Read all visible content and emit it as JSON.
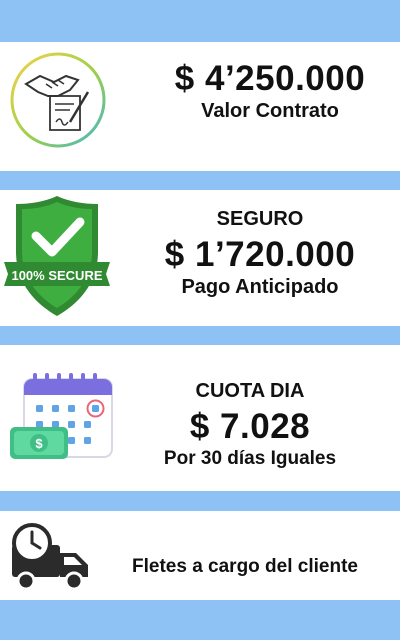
{
  "contract": {
    "amount": "$ 4’250.000",
    "label": "Valor Contrato",
    "icon": "handshake-contract-icon"
  },
  "insurance": {
    "title": "SEGURO",
    "amount": "$ 1’720.000",
    "label": "Pago Anticipado",
    "badge_text": "100% SECURE",
    "icon": "secure-shield-icon"
  },
  "daily_fee": {
    "title": "CUOTA DIA",
    "amount": "$ 7.028",
    "label": "Por 30 días Iguales",
    "icon": "calendar-money-icon"
  },
  "shipping": {
    "label": "Fletes a cargo del cliente",
    "icon": "delivery-truck-clock-icon"
  },
  "colors": {
    "background": "#8ec2f5",
    "card": "#ffffff",
    "shield": "#3a9b3c",
    "calendar_accent": "#7b6fe0",
    "money": "#4fd19a"
  }
}
